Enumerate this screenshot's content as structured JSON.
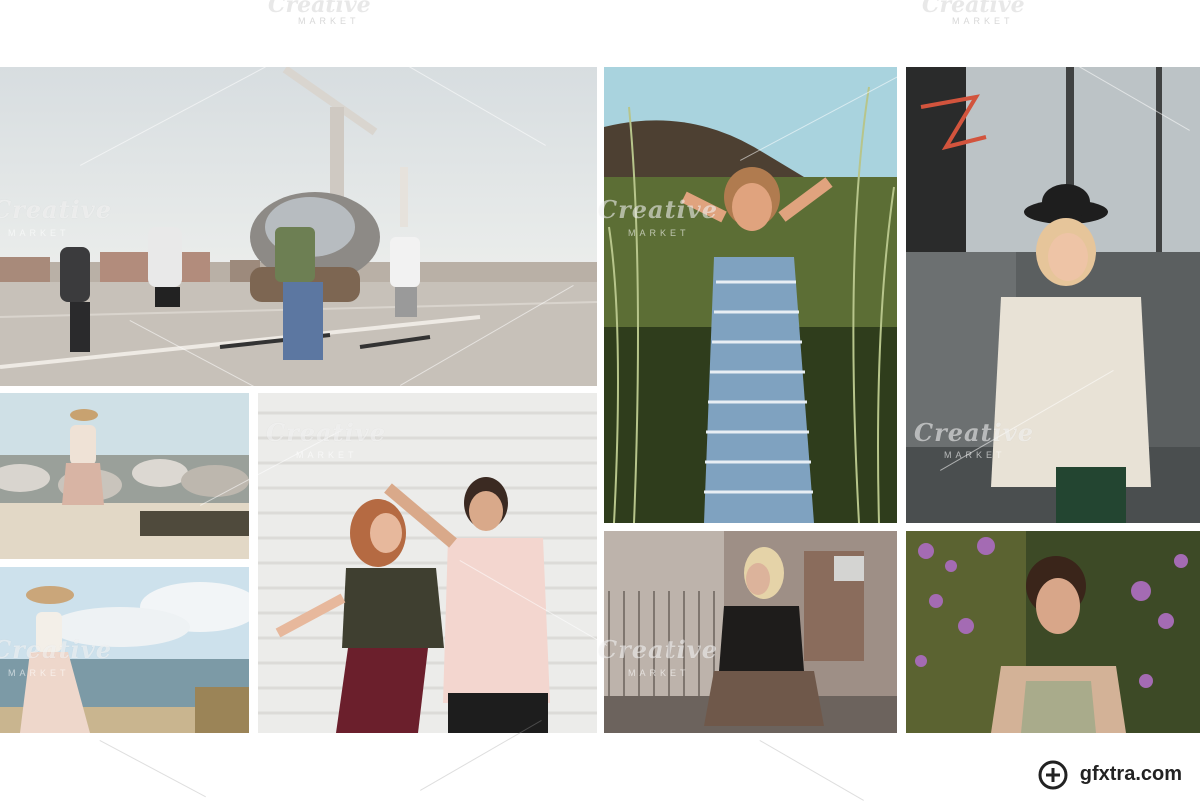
{
  "watermark": {
    "brand": "Creative",
    "sub": "MARKET"
  },
  "footer": {
    "site": "gfxtra.com",
    "icon": "gfxtra-logo-icon"
  },
  "colors": {
    "background": "#ffffff",
    "watermark": "#e8e8e8"
  }
}
